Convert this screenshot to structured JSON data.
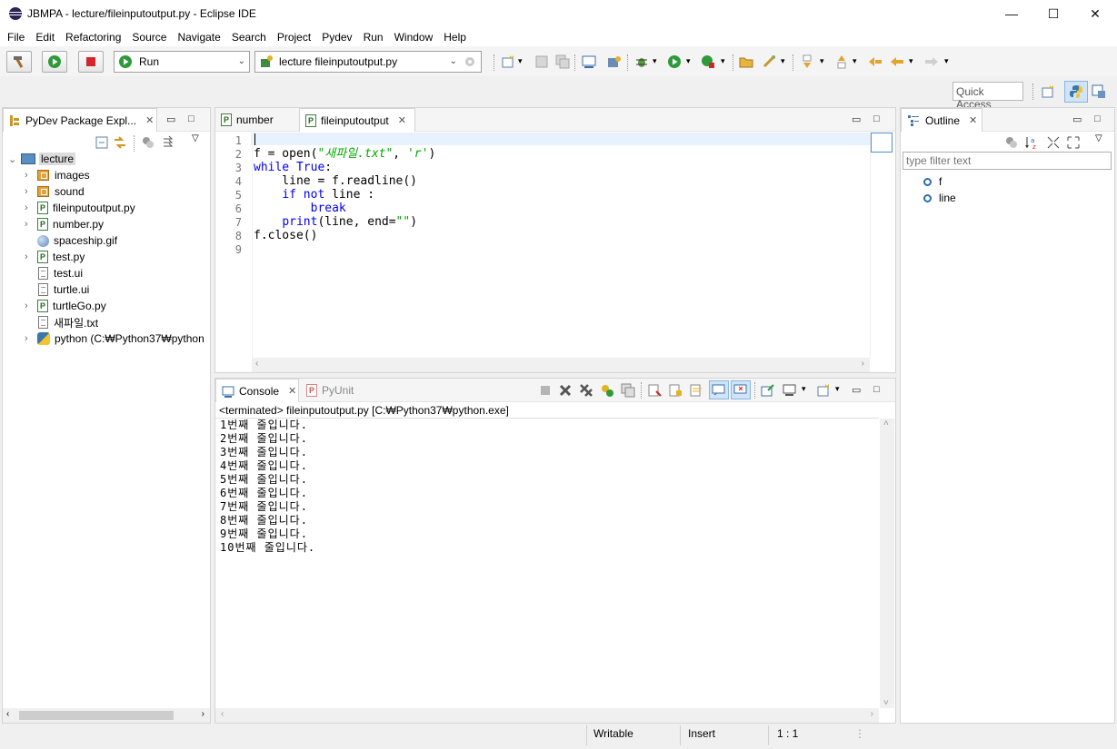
{
  "window": {
    "title": "JBMPA - lecture/fileinputoutput.py - Eclipse IDE",
    "minimize": "—",
    "maximize": "☐",
    "close": "✕"
  },
  "menu": [
    "File",
    "Edit",
    "Refactoring",
    "Source",
    "Navigate",
    "Search",
    "Project",
    "Pydev",
    "Run",
    "Window",
    "Help"
  ],
  "toolbar": {
    "run_config": "Run",
    "launch_target": "lecture fileinputoutput.py",
    "quick_access_placeholder": "Quick Access"
  },
  "package_explorer": {
    "tab_label": "PyDev Package Expl...",
    "project": "lecture",
    "items": [
      {
        "label": "images",
        "icon": "package-folder-icon",
        "expandable": true
      },
      {
        "label": "sound",
        "icon": "package-folder-icon",
        "expandable": true
      },
      {
        "label": "fileinputoutput.py",
        "icon": "python-file-icon",
        "expandable": true
      },
      {
        "label": "number.py",
        "icon": "python-file-icon",
        "expandable": true
      },
      {
        "label": "spaceship.gif",
        "icon": "image-file-icon",
        "expandable": false
      },
      {
        "label": "test.py",
        "icon": "python-file-icon",
        "expandable": true
      },
      {
        "label": "test.ui",
        "icon": "text-file-icon",
        "expandable": false
      },
      {
        "label": "turtle.ui",
        "icon": "text-file-icon",
        "expandable": false
      },
      {
        "label": "turtleGo.py",
        "icon": "python-file-icon",
        "expandable": true
      },
      {
        "label": "새파일.txt",
        "icon": "text-file-icon",
        "expandable": false
      },
      {
        "label": "python   (C:₩Python37₩python",
        "icon": "python-interpreter-icon",
        "expandable": true
      }
    ]
  },
  "editor": {
    "tabs": [
      {
        "label": "number",
        "active": false
      },
      {
        "label": "fileinputoutput",
        "active": true
      }
    ],
    "line_numbers": [
      "1",
      "2",
      "3",
      "4",
      "5",
      "6",
      "7",
      "8",
      "9"
    ],
    "code": [
      [],
      [
        {
          "t": "f = open(",
          "c": "plain"
        },
        {
          "t": "\"새파일.txt\"",
          "c": "str"
        },
        {
          "t": ", ",
          "c": "plain"
        },
        {
          "t": "'r'",
          "c": "str"
        },
        {
          "t": ")",
          "c": "plain"
        }
      ],
      [
        {
          "t": "while",
          "c": "kw"
        },
        {
          "t": " ",
          "c": "plain"
        },
        {
          "t": "True",
          "c": "kw"
        },
        {
          "t": ":",
          "c": "plain"
        }
      ],
      [
        {
          "t": "    line = f.readline()",
          "c": "plain"
        }
      ],
      [
        {
          "t": "    ",
          "c": "plain"
        },
        {
          "t": "if",
          "c": "kw"
        },
        {
          "t": " ",
          "c": "plain"
        },
        {
          "t": "not",
          "c": "kw"
        },
        {
          "t": " line :",
          "c": "plain"
        }
      ],
      [
        {
          "t": "        ",
          "c": "plain"
        },
        {
          "t": "break",
          "c": "kw"
        }
      ],
      [
        {
          "t": "    ",
          "c": "plain"
        },
        {
          "t": "print",
          "c": "kw"
        },
        {
          "t": "(line, end=",
          "c": "plain"
        },
        {
          "t": "\"\"",
          "c": "str"
        },
        {
          "t": ")",
          "c": "plain"
        }
      ],
      [
        {
          "t": "f.close()",
          "c": "plain"
        }
      ],
      []
    ]
  },
  "outline": {
    "tab_label": "Outline",
    "filter_placeholder": "type filter text",
    "items": [
      "f",
      "line"
    ]
  },
  "console": {
    "tabs": [
      {
        "label": "Console",
        "active": true
      },
      {
        "label": "PyUnit",
        "active": false
      }
    ],
    "header": "<terminated> fileinputoutput.py [C:₩Python37₩python.exe]",
    "lines": [
      "1번째 줄입니다.",
      "2번째 줄입니다.",
      "3번째 줄입니다.",
      "4번째 줄입니다.",
      "5번째 줄입니다.",
      "6번째 줄입니다.",
      "7번째 줄입니다.",
      "8번째 줄입니다.",
      "9번째 줄입니다.",
      "10번째 줄입니다."
    ]
  },
  "statusbar": {
    "mode": "Writable",
    "insert": "Insert",
    "position": "1 : 1"
  }
}
